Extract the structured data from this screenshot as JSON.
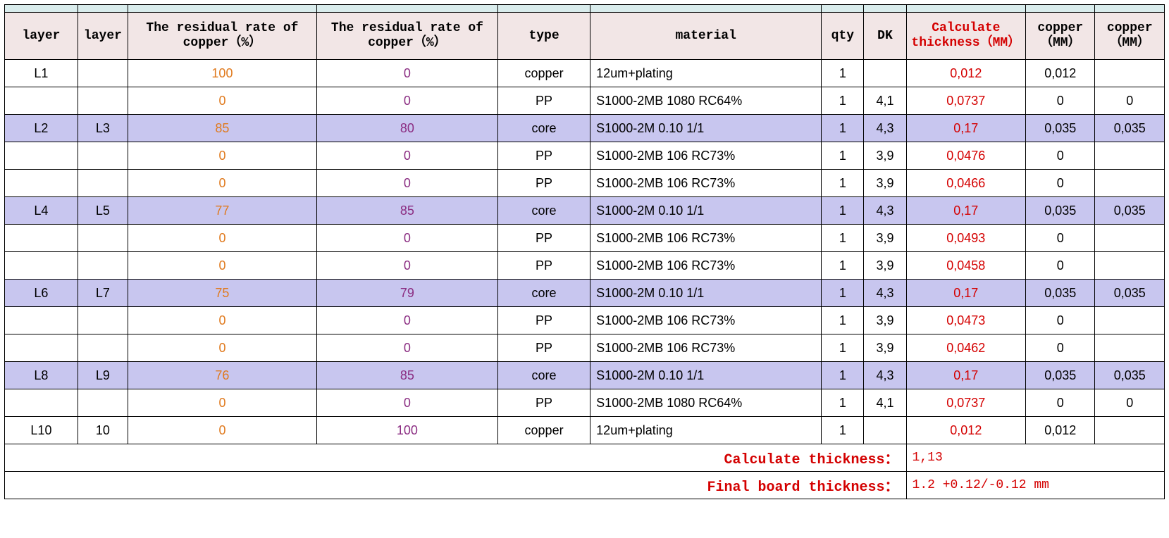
{
  "headers": {
    "layer1": "layer",
    "layer2": "layer",
    "res1": "The residual rate of copper（%）",
    "res2": "The residual rate of copper（%）",
    "type": "type",
    "material": "material",
    "qty": "qty",
    "dk": "DK",
    "calc": "Calculate thickness（MM）",
    "cu1": "copper（MM）",
    "cu2": "copper（MM）"
  },
  "rows": [
    {
      "layer1": "L1",
      "layer2": "",
      "res1": "100",
      "res2": "0",
      "type": "copper",
      "material": "12um+plating",
      "qty": "1",
      "dk": "",
      "calc": "0,012",
      "cu1": "0,012",
      "cu2": "",
      "core": false
    },
    {
      "layer1": "",
      "layer2": "",
      "res1": "0",
      "res2": "0",
      "type": "PP",
      "material": "S1000-2MB  1080 RC64%",
      "qty": "1",
      "dk": "4,1",
      "calc": "0,0737",
      "cu1": "0",
      "cu2": "0",
      "core": false
    },
    {
      "layer1": "L2",
      "layer2": "L3",
      "res1": "85",
      "res2": "80",
      "type": "core",
      "material": "S1000-2M 0.10 1/1",
      "qty": "1",
      "dk": "4,3",
      "calc": "0,17",
      "cu1": "0,035",
      "cu2": "0,035",
      "core": true
    },
    {
      "layer1": "",
      "layer2": "",
      "res1": "0",
      "res2": "0",
      "type": "PP",
      "material": "S1000-2MB  106 RC73%",
      "qty": "1",
      "dk": "3,9",
      "calc": "0,0476",
      "cu1": "0",
      "cu2": "",
      "core": false
    },
    {
      "layer1": "",
      "layer2": "",
      "res1": "0",
      "res2": "0",
      "type": "PP",
      "material": "S1000-2MB  106 RC73%",
      "qty": "1",
      "dk": "3,9",
      "calc": "0,0466",
      "cu1": "0",
      "cu2": "",
      "core": false
    },
    {
      "layer1": "L4",
      "layer2": "L5",
      "res1": "77",
      "res2": "85",
      "type": "core",
      "material": "S1000-2M 0.10 1/1",
      "qty": "1",
      "dk": "4,3",
      "calc": "0,17",
      "cu1": "0,035",
      "cu2": "0,035",
      "core": true
    },
    {
      "layer1": "",
      "layer2": "",
      "res1": "0",
      "res2": "0",
      "type": "PP",
      "material": "S1000-2MB  106 RC73%",
      "qty": "1",
      "dk": "3,9",
      "calc": "0,0493",
      "cu1": "0",
      "cu2": "",
      "core": false
    },
    {
      "layer1": "",
      "layer2": "",
      "res1": "0",
      "res2": "0",
      "type": "PP",
      "material": "S1000-2MB  106 RC73%",
      "qty": "1",
      "dk": "3,9",
      "calc": "0,0458",
      "cu1": "0",
      "cu2": "",
      "core": false
    },
    {
      "layer1": "L6",
      "layer2": "L7",
      "res1": "75",
      "res2": "79",
      "type": "core",
      "material": "S1000-2M 0.10 1/1",
      "qty": "1",
      "dk": "4,3",
      "calc": "0,17",
      "cu1": "0,035",
      "cu2": "0,035",
      "core": true
    },
    {
      "layer1": "",
      "layer2": "",
      "res1": "0",
      "res2": "0",
      "type": "PP",
      "material": "S1000-2MB  106 RC73%",
      "qty": "1",
      "dk": "3,9",
      "calc": "0,0473",
      "cu1": "0",
      "cu2": "",
      "core": false
    },
    {
      "layer1": "",
      "layer2": "",
      "res1": "0",
      "res2": "0",
      "type": "PP",
      "material": "S1000-2MB  106 RC73%",
      "qty": "1",
      "dk": "3,9",
      "calc": "0,0462",
      "cu1": "0",
      "cu2": "",
      "core": false
    },
    {
      "layer1": "L8",
      "layer2": "L9",
      "res1": "76",
      "res2": "85",
      "type": "core",
      "material": "S1000-2M 0.10 1/1",
      "qty": "1",
      "dk": "4,3",
      "calc": "0,17",
      "cu1": "0,035",
      "cu2": "0,035",
      "core": true
    },
    {
      "layer1": "",
      "layer2": "",
      "res1": "0",
      "res2": "0",
      "type": "PP",
      "material": "S1000-2MB  1080 RC64%",
      "qty": "1",
      "dk": "4,1",
      "calc": "0,0737",
      "cu1": "0",
      "cu2": "0",
      "core": false
    },
    {
      "layer1": "L10",
      "layer2": "10",
      "res1": "0",
      "res2": "100",
      "type": "copper",
      "material": "12um+plating",
      "qty": "1",
      "dk": "",
      "calc": "0,012",
      "cu1": "0,012",
      "cu2": "",
      "core": false
    }
  ],
  "summary": {
    "calc_label": "Calculate thickness：",
    "calc_value": "1,13",
    "final_label": "Final board thickness：",
    "final_value": "1.2 +0.12/-0.12 mm"
  }
}
